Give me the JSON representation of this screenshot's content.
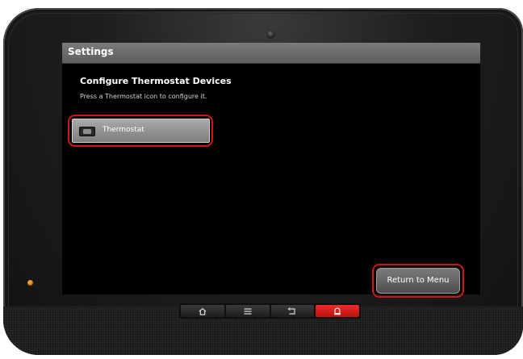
{
  "screen": {
    "title": "Settings",
    "heading": "Configure Thermostat Devices",
    "instructions": "Press a Thermostat icon to configure it.",
    "devices": [
      {
        "label": "Thermostat",
        "icon": "thermostat-icon"
      }
    ],
    "return_button_label": "Return to Menu"
  },
  "hardware_buttons": [
    {
      "name": "home",
      "icon": "home-icon"
    },
    {
      "name": "menu",
      "icon": "menu-icon"
    },
    {
      "name": "back",
      "icon": "back-icon"
    },
    {
      "name": "alarm",
      "icon": "alarm-icon"
    }
  ],
  "colors": {
    "highlight": "#d0141b",
    "title_bar": "#6e6e6e",
    "alarm_button": "#e01f1f",
    "status_led": "#e08a1c"
  }
}
